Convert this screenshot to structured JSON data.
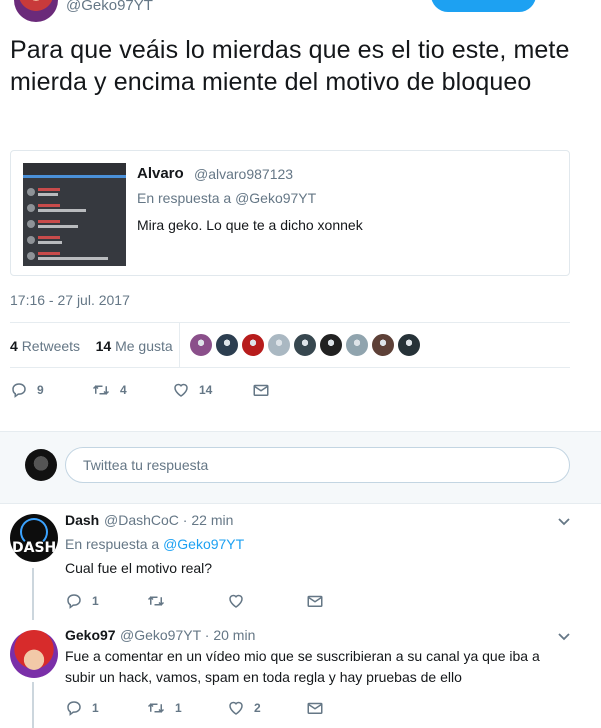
{
  "header": {
    "handle": "@Geko97YT"
  },
  "tweet": {
    "text": "Para que veáis lo mierdas que es el tio este, mete mierda y encima miente del motivo de bloqueo",
    "timestamp": "17:16 - 27 jul. 2017",
    "retweets_count": "4",
    "retweets_label": "Retweets",
    "likes_count": "14",
    "likes_label": "Me gusta",
    "actions": {
      "replies": "9",
      "retweets": "4",
      "likes": "14"
    }
  },
  "quote": {
    "name": "Alvaro",
    "handle": "@alvaro987123",
    "reply_prefix": "En respuesta a",
    "reply_to": "@Geko97YT",
    "text": "Mira geko. Lo que te a dicho xonnek"
  },
  "compose": {
    "placeholder": "Twittea tu respuesta"
  },
  "likers": [
    {
      "color": "#8a4f8a"
    },
    {
      "color": "#2c3e50"
    },
    {
      "color": "#b71c1c"
    },
    {
      "color": "#aab8c2"
    },
    {
      "color": "#37474f"
    },
    {
      "color": "#212121"
    },
    {
      "color": "#90a4ae"
    },
    {
      "color": "#5d4037"
    },
    {
      "color": "#263238"
    }
  ],
  "replies": [
    {
      "name": "Dash",
      "handle": "@DashCoC",
      "sep": "·",
      "time": "22 min",
      "reply_prefix": "En respuesta a",
      "reply_to": "@Geko97YT",
      "text": "Cual fue el motivo real?",
      "actions": {
        "replies": "1",
        "retweets": "",
        "likes": ""
      },
      "avatar_text": "DASH"
    },
    {
      "name": "Geko97",
      "handle": "@Geko97YT",
      "sep": "·",
      "time": "20 min",
      "text": "Fue a comentar en un vídeo mio que se suscribieran a su canal ya que iba a subir un hack, vamos, spam en toda regla y hay pruebas de ello",
      "actions": {
        "replies": "1",
        "retweets": "1",
        "likes": "2"
      }
    }
  ],
  "colors": {
    "accent": "#1da1f2",
    "muted": "#657786",
    "text": "#14171a"
  }
}
